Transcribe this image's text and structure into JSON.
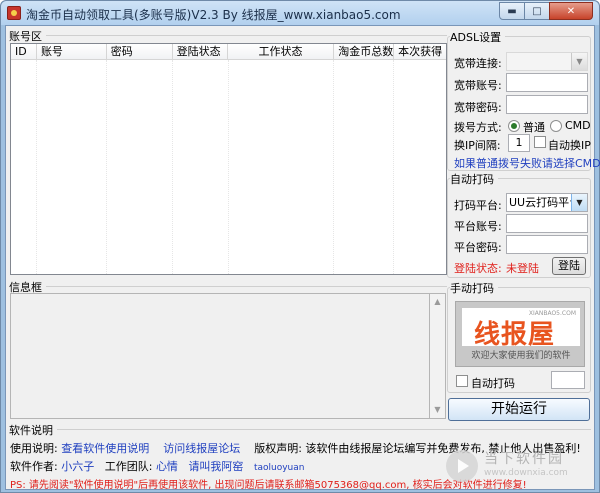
{
  "window": {
    "title": "淘金币自动领取工具(多账号版)V2.3 By 线报屋_www.xianbao5.com"
  },
  "accounts": {
    "group_title": "账号区",
    "columns": [
      "ID",
      "账号",
      "密码",
      "登陆状态",
      "工作状态",
      "淘金币总数",
      "本次获得"
    ]
  },
  "info": {
    "group_title": "信息框"
  },
  "adsl": {
    "group_title": "ADSL设置",
    "connection_label": "宽带连接:",
    "account_label": "宽带账号:",
    "password_label": "宽带密码:",
    "dial_mode_label": "拨号方式:",
    "dial_mode_options": [
      "普通",
      "CMD"
    ],
    "interval_label": "换IP间隔:",
    "interval_value": "1",
    "auto_switch_label": "自动换IP",
    "hint_link": "如果普通拨号失败请选择CMD"
  },
  "auto_captcha": {
    "group_title": "自动打码",
    "platform_label": "打码平台:",
    "platform_value": "UU云打码平台",
    "account_label": "平台账号:",
    "password_label": "平台密码:",
    "status_label": "登陆状态:",
    "status_value": "未登陆",
    "login_button": "登陆"
  },
  "manual_captcha": {
    "group_title": "手动打码",
    "logo_title": "线报屋",
    "logo_corner": "XIANBAO5.COM",
    "logo_slogan": "欢迎大家使用我们的软件",
    "auto_captcha_label": "自动打码"
  },
  "start_button": "开始运行",
  "software_info": {
    "group_title": "软件说明",
    "usage_label": "使用说明:",
    "usage_link": "查看软件使用说明",
    "forum_link": "访问线报屋论坛",
    "copyright": "版权声明: 该软件由线报屋论坛编写并免费发布, 禁止他人出售盈利!",
    "author_label": "软件作者:",
    "author_link": "小六子",
    "team_label": "工作团队:",
    "team_link1": "心情",
    "team_link2": "请叫我阿窑",
    "team_link3": "taoluoyuan",
    "ps_note": "PS: 请先阅读\"软件使用说明\"后再使用该软件, 出现问题后请联系邮箱5075368@qq.com, 核实后会对软件进行修复!"
  },
  "watermark": {
    "title": "当下软件园",
    "subtitle": "www.downxia.com"
  }
}
